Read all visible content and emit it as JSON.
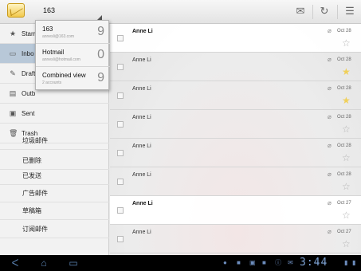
{
  "account_spinner": {
    "label": "163"
  },
  "toolbar": {
    "compose_icon": "compose-icon",
    "refresh_icon": "refresh-icon",
    "menu_icon": "menu-icon"
  },
  "accounts_popup": [
    {
      "name": "163",
      "address": "annesli@163.com",
      "count": "9"
    },
    {
      "name": "Hotmail",
      "address": "annesli@hotmail.com",
      "count": "0"
    },
    {
      "name": "Combined view",
      "address": "2 accounts",
      "count": "9"
    }
  ],
  "folders": [
    {
      "label": "Starr",
      "icon": "star-icon"
    },
    {
      "label": "Inbo",
      "icon": "inbox-icon"
    },
    {
      "label": "Draft",
      "icon": "drafts-icon"
    },
    {
      "label": "Outb",
      "icon": "outbox-icon"
    },
    {
      "label": "Sent",
      "icon": "sent-icon"
    },
    {
      "label": "Trash",
      "icon": "trash-icon"
    },
    {
      "label": "垃圾邮件"
    },
    {
      "label": "已删除"
    },
    {
      "label": "已发送"
    },
    {
      "label": "广告邮件"
    },
    {
      "label": "草稿箱"
    },
    {
      "label": "订阅邮件"
    }
  ],
  "messages": [
    {
      "sender": "Anne Li",
      "date": "Oct 28",
      "unread": true,
      "starred": false
    },
    {
      "sender": "Anne Li",
      "date": "Oct 28",
      "unread": false,
      "starred": true
    },
    {
      "sender": "Anne Li",
      "date": "Oct 28",
      "unread": false,
      "starred": true
    },
    {
      "sender": "Anne Li",
      "date": "Oct 28",
      "unread": false,
      "starred": false
    },
    {
      "sender": "Anne Li",
      "date": "Oct 28",
      "unread": false,
      "starred": false
    },
    {
      "sender": "Anne Li",
      "date": "Oct 28",
      "unread": false,
      "starred": false
    },
    {
      "sender": "Anne Li",
      "date": "Oct 27",
      "unread": true,
      "starred": false
    },
    {
      "sender": "Anne Li",
      "date": "Oct 27",
      "unread": false,
      "starred": false
    }
  ],
  "status_bar": {
    "time": "3:44"
  },
  "colors": {
    "selected_folder": "#b8c8d8",
    "star_on": "#f0d05a",
    "sysbar_icons": "#7fa4d6"
  }
}
